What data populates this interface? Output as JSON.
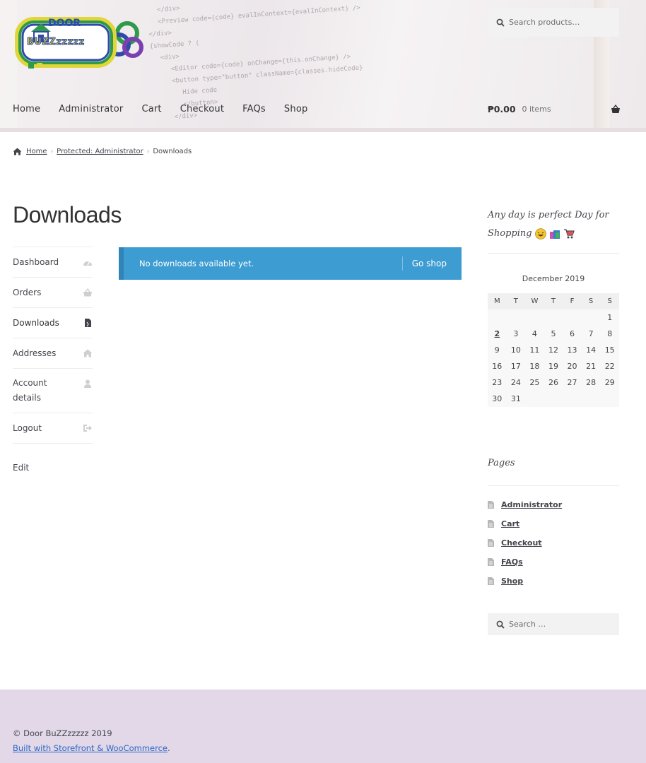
{
  "header": {
    "logo_alt": "Door BuZZzzzzz",
    "logo_text_top": "DOOR",
    "logo_text_bottom": "BUZZzzzzz",
    "search_placeholder": "Search products…",
    "nav": [
      "Home",
      "Administrator",
      "Cart",
      "Checkout",
      "FAQs",
      "Shop"
    ],
    "cart_amount": "₱0.00",
    "cart_items": "0 items",
    "code_lines": [
      "</div>",
      "<Preview code={code} evalInContext={evalInContext} />",
      "</div>",
      "{showCode ? (",
      "<div>",
      "<Editor code={code} onChange={this.onChange} />",
      "<button type=\"button\" className={classes.hideCode}",
      "Hide code",
      "</button>",
      "</div>"
    ]
  },
  "breadcrumb": {
    "home": "Home",
    "parent": "Protected: Administrator",
    "current": "Downloads",
    "separator": "›"
  },
  "page_title": "Downloads",
  "account_nav": {
    "items": [
      {
        "label": "Dashboard",
        "icon": "dashboard-icon"
      },
      {
        "label": "Orders",
        "icon": "basket-icon"
      },
      {
        "label": "Downloads",
        "icon": "file-icon"
      },
      {
        "label": "Addresses",
        "icon": "home-icon"
      },
      {
        "label": "Account details",
        "icon": "user-icon"
      },
      {
        "label": "Logout",
        "icon": "sign-out-icon"
      }
    ],
    "edit": "Edit"
  },
  "notice": {
    "message": "No downloads available yet.",
    "button": "Go shop",
    "color": "#3d9cd2"
  },
  "sidebar": {
    "tagline_line1": "Any day is perfect Day for",
    "tagline_line2": "Shopping",
    "calendar": {
      "caption": "December 2019",
      "headers": [
        "M",
        "T",
        "W",
        "T",
        "F",
        "S",
        "S"
      ],
      "rows": [
        [
          "",
          "",
          "",
          "",
          "",
          "",
          "1"
        ],
        [
          "2",
          "3",
          "4",
          "5",
          "6",
          "7",
          "8"
        ],
        [
          "9",
          "10",
          "11",
          "12",
          "13",
          "14",
          "15"
        ],
        [
          "16",
          "17",
          "18",
          "19",
          "20",
          "21",
          "22"
        ],
        [
          "23",
          "24",
          "25",
          "26",
          "27",
          "28",
          "29"
        ],
        [
          "30",
          "31",
          "",
          "",
          "",
          "",
          ""
        ]
      ],
      "linked_day": "2"
    },
    "pages_heading": "Pages",
    "pages": [
      "Administrator",
      "Cart",
      "Checkout",
      "FAQs",
      "Shop"
    ],
    "search_placeholder": "Search …"
  },
  "footer": {
    "copyright": "© Door BuZZzzzzz 2019",
    "built_with": "Built with Storefront & WooCommerce",
    "built_suffix": ".",
    "background": "#e2d8e8"
  }
}
